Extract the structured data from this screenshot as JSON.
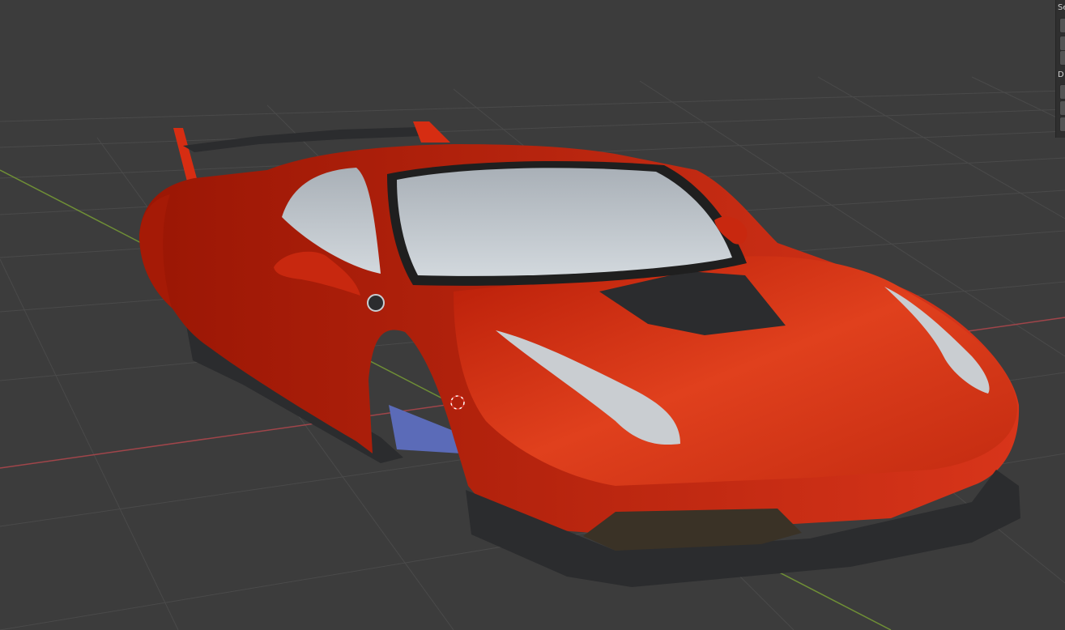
{
  "viewport": {
    "object": "sports-car-model",
    "background_color": "#3c3c3c",
    "x_axis_color": "#a0454a",
    "y_axis_color": "#6f8f36",
    "body_color": "#d62d12",
    "glass_color": "#bfc6cd",
    "carbon_color": "#2b2c2e",
    "shadow_color": "#5b6bb8"
  },
  "side_panel": {
    "section_1_label": "Se",
    "section_2_label": "D"
  }
}
